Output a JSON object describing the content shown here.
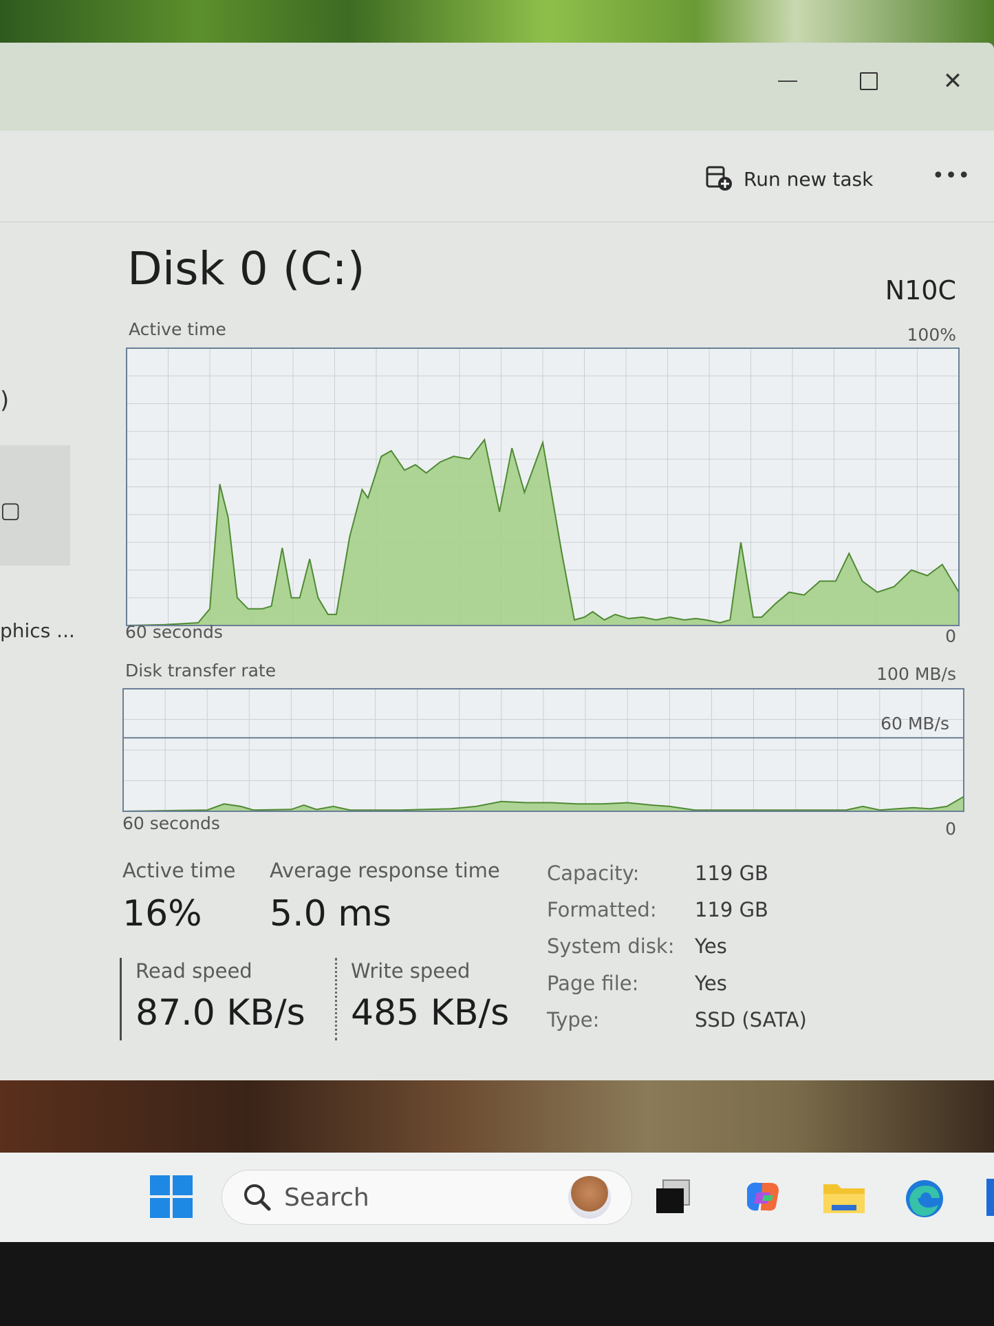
{
  "toolbar": {
    "run_new_task": "Run new task",
    "more": "•••"
  },
  "sidebar": {
    "fragment_top": ")",
    "fragment_label": "phics ..."
  },
  "disk": {
    "title": "Disk 0 (C:)",
    "model": "N10C"
  },
  "active_chart": {
    "label": "Active time",
    "max": "100%",
    "time_label": "60 seconds",
    "min": "0",
    "chart_data": {
      "type": "area",
      "title": "Active time",
      "ylim": [
        0,
        100
      ],
      "x_label": "60 seconds",
      "points": [
        [
          0,
          0
        ],
        [
          4.6,
          0.3
        ],
        [
          8.6,
          1
        ],
        [
          10,
          6
        ],
        [
          11.2,
          51
        ],
        [
          12.2,
          39
        ],
        [
          13.3,
          10
        ],
        [
          14.6,
          6
        ],
        [
          16.3,
          6
        ],
        [
          17.4,
          7
        ],
        [
          18.7,
          28
        ],
        [
          19.8,
          10
        ],
        [
          20.8,
          10
        ],
        [
          22,
          24
        ],
        [
          23,
          10
        ],
        [
          24.2,
          4
        ],
        [
          25.2,
          4
        ],
        [
          26.8,
          32
        ],
        [
          28.3,
          49
        ],
        [
          29,
          46
        ],
        [
          30.6,
          61
        ],
        [
          31.8,
          63
        ],
        [
          33.4,
          56
        ],
        [
          34.7,
          58
        ],
        [
          36,
          55
        ],
        [
          37.7,
          59
        ],
        [
          39.3,
          61
        ],
        [
          41.2,
          60
        ],
        [
          43,
          67
        ],
        [
          44.8,
          41
        ],
        [
          46.3,
          64
        ],
        [
          47.8,
          48
        ],
        [
          50,
          66
        ],
        [
          52.3,
          26
        ],
        [
          53.8,
          2
        ],
        [
          55,
          3
        ],
        [
          56,
          5
        ],
        [
          57.4,
          2
        ],
        [
          58.7,
          4
        ],
        [
          60.3,
          2.5
        ],
        [
          62,
          3
        ],
        [
          63.6,
          2
        ],
        [
          65.3,
          3
        ],
        [
          67,
          2
        ],
        [
          68.4,
          2.5
        ],
        [
          69.6,
          2
        ],
        [
          71.3,
          1
        ],
        [
          72.5,
          2
        ],
        [
          73.8,
          30
        ],
        [
          75.3,
          3
        ],
        [
          76.3,
          3
        ],
        [
          78,
          8
        ],
        [
          79.6,
          12
        ],
        [
          81.4,
          11
        ],
        [
          83.3,
          16
        ],
        [
          85.2,
          16
        ],
        [
          86.8,
          26
        ],
        [
          88.4,
          16
        ],
        [
          90.2,
          12
        ],
        [
          92.2,
          14
        ],
        [
          94.3,
          20
        ],
        [
          96.2,
          18
        ],
        [
          98,
          22
        ],
        [
          100,
          12
        ]
      ]
    }
  },
  "transfer_chart": {
    "label": "Disk transfer rate",
    "max": "100 MB/s",
    "mid": "60 MB/s",
    "time_label": "60 seconds",
    "min": "0",
    "chart_data": {
      "type": "area",
      "title": "Disk transfer rate",
      "ylim": [
        0,
        100
      ],
      "reference_line": 60,
      "x_label": "60 seconds",
      "points": [
        [
          0,
          0
        ],
        [
          10,
          1
        ],
        [
          12,
          6
        ],
        [
          14,
          4
        ],
        [
          15.5,
          1
        ],
        [
          20,
          1.5
        ],
        [
          21.5,
          5
        ],
        [
          23,
          1.5
        ],
        [
          25,
          4
        ],
        [
          27,
          1
        ],
        [
          30,
          1
        ],
        [
          33,
          1
        ],
        [
          36,
          1.5
        ],
        [
          39,
          2
        ],
        [
          42,
          4
        ],
        [
          45,
          8
        ],
        [
          48,
          7
        ],
        [
          51,
          7
        ],
        [
          54,
          6
        ],
        [
          57,
          6
        ],
        [
          60,
          7
        ],
        [
          63,
          5
        ],
        [
          65,
          4
        ],
        [
          68,
          1
        ],
        [
          72,
          1
        ],
        [
          78,
          1
        ],
        [
          82,
          1
        ],
        [
          86,
          1
        ],
        [
          88,
          4
        ],
        [
          90,
          1
        ],
        [
          92,
          2
        ],
        [
          94,
          3
        ],
        [
          96,
          2
        ],
        [
          98,
          4
        ],
        [
          100,
          12
        ]
      ]
    }
  },
  "stats": {
    "active_time_label": "Active time",
    "active_time_value": "16%",
    "avg_response_label": "Average response time",
    "avg_response_value": "5.0 ms",
    "read_speed_label": "Read speed",
    "read_speed_value": "87.0 KB/s",
    "write_speed_label": "Write speed",
    "write_speed_value": "485 KB/s"
  },
  "properties": [
    {
      "label": "Capacity:",
      "value": "119 GB"
    },
    {
      "label": "Formatted:",
      "value": "119 GB"
    },
    {
      "label": "System disk:",
      "value": "Yes"
    },
    {
      "label": "Page file:",
      "value": "Yes"
    },
    {
      "label": "Type:",
      "value": "SSD (SATA)"
    }
  ],
  "taskbar": {
    "search_placeholder": "Search"
  },
  "colors": {
    "fill": "#a5d08a",
    "stroke": "#4f8a34",
    "grid": "#c9cfd4",
    "border": "#6a7f96"
  }
}
